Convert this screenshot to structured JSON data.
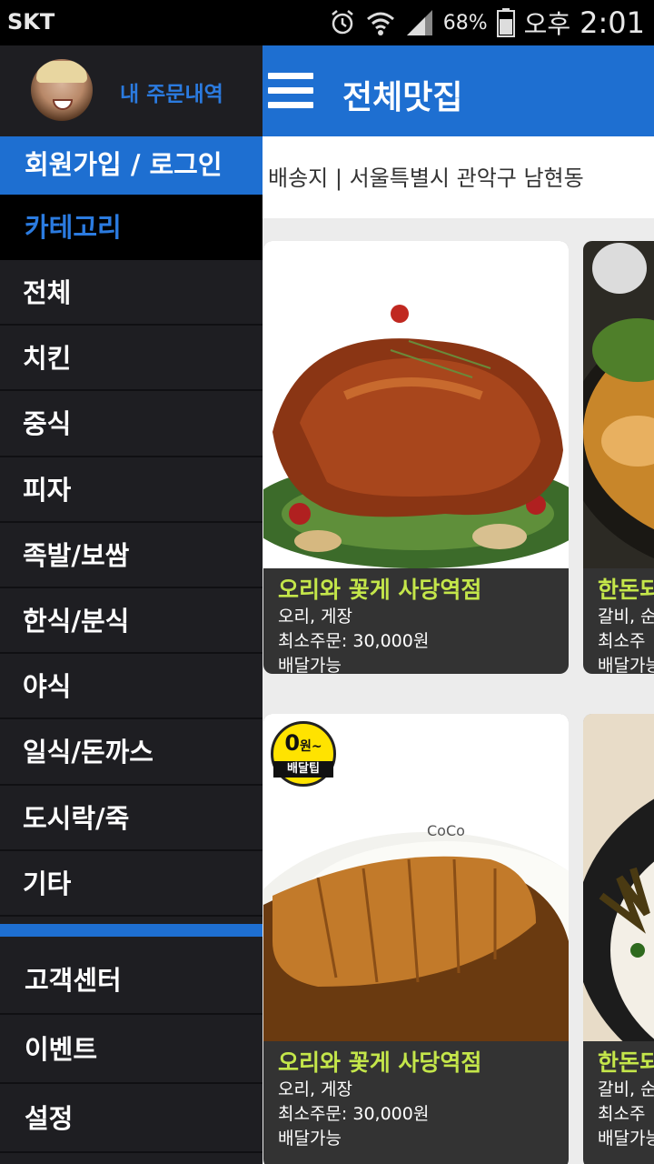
{
  "status_bar": {
    "carrier": "SKT",
    "battery": "68%",
    "ampm": "오후",
    "time": "2:01",
    "icons": [
      "alarm-icon",
      "wifi-icon",
      "signal-icon",
      "battery-icon"
    ]
  },
  "drawer": {
    "my_orders": "내 주문내역",
    "login": "회원가입 / 로그인",
    "category_header": "카테고리",
    "categories": [
      "전체",
      "치킨",
      "중식",
      "피자",
      "족발/보쌈",
      "한식/분식",
      "야식",
      "일식/돈까스",
      "도시락/죽",
      "기타"
    ],
    "bottom_items": [
      "고객센터",
      "이벤트",
      "설정"
    ]
  },
  "main": {
    "title": "전체맛집",
    "address": "배송지 | 서울특별시 관악구 남현동",
    "cards": [
      {
        "name": "오리와 꽃게 사당역점",
        "menu": "오리, 게장",
        "min_order": "최소주문: 30,000원",
        "status": "배달가능"
      },
      {
        "name": "한돈되",
        "menu": "갈비, 순",
        "min_order": "최소주",
        "status": "배달가능"
      },
      {
        "name": "오리와 꽃게 사당역점",
        "menu": "오리, 게장",
        "min_order": "최소주문: 30,000원",
        "status": "배달가능"
      },
      {
        "name": "한돈되",
        "menu": "갈비, 순",
        "min_order": "최소주",
        "status": "배달가능"
      }
    ],
    "badge": {
      "amount": "0",
      "unit": "원~",
      "label": "배달팁"
    }
  },
  "colors": {
    "accent": "#1e6fd1",
    "drawer_bg": "#1e1e22",
    "card_name": "#c4e64a",
    "badge": "#ffe300"
  }
}
